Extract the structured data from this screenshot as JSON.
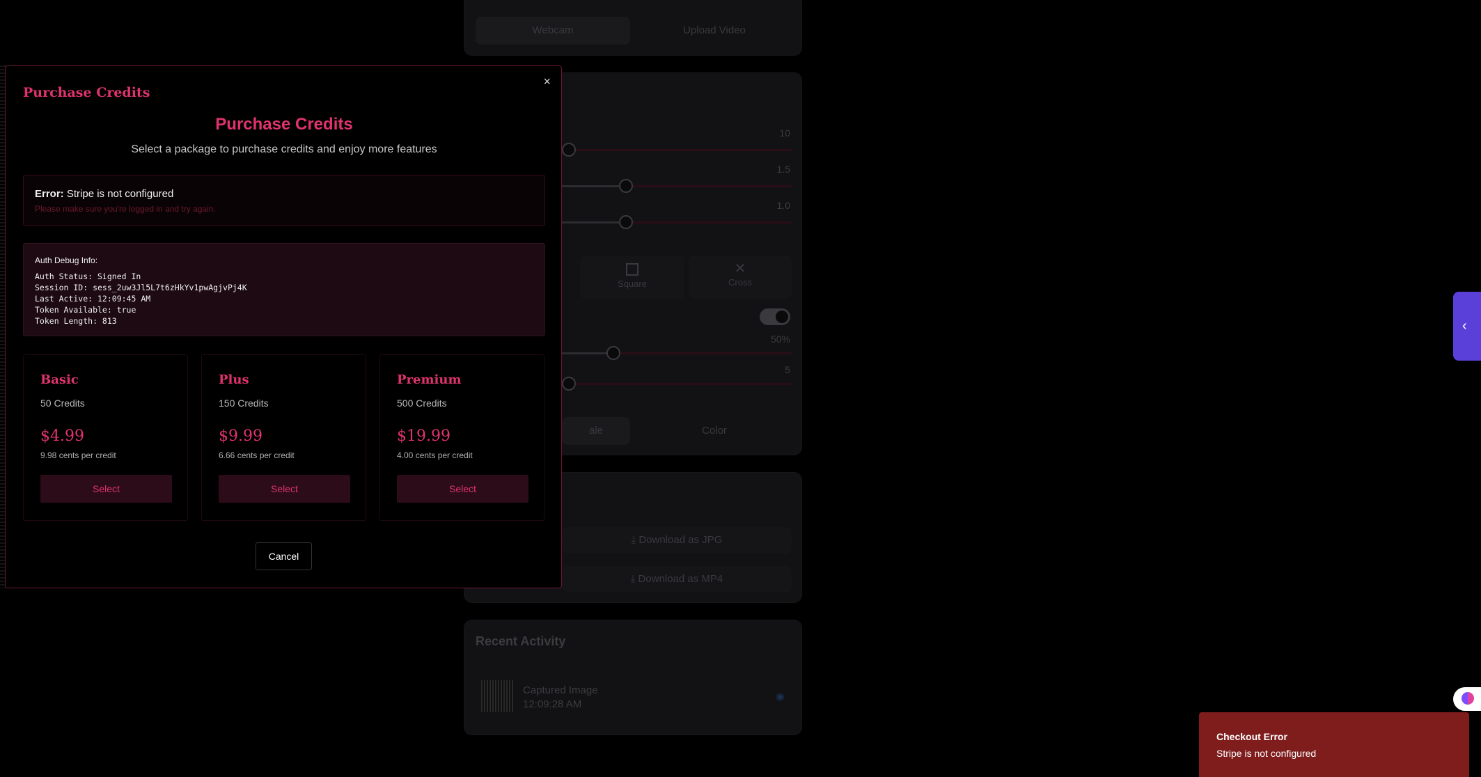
{
  "background": {
    "source_tabs": [
      "Webcam",
      "Upload Video"
    ],
    "slider_values": [
      "10",
      "1.5",
      "1.0",
      "50%",
      "5"
    ],
    "shapes": [
      "Square",
      "Cross"
    ],
    "mode_tabs": [
      "ale",
      "Color"
    ],
    "downloads": [
      "Download as JPG",
      "Download as MP4"
    ],
    "recent": {
      "title": "Recent Activity",
      "item_title": "Captured Image",
      "item_time": "12:09:28 AM"
    }
  },
  "modal": {
    "header_title": "Purchase Credits",
    "heading": "Purchase Credits",
    "subtitle": "Select a package to purchase credits and enjoy more features",
    "close_glyph": "×",
    "error": {
      "label": "Error:",
      "message": "Stripe is not configured",
      "hint": "Please make sure you're logged in and try again."
    },
    "debug": {
      "title": "Auth Debug Info:",
      "lines": "Auth Status: Signed In\nSession ID: sess_2uw3Jl5L7t6zHkYv1pwAgjvPj4K\nLast Active: 12:09:45 AM\nToken Available: true\nToken Length: 813"
    },
    "packages": [
      {
        "name": "Basic",
        "credits": "50 Credits",
        "price": "$4.99",
        "per": "9.98 cents per credit",
        "button": "Select"
      },
      {
        "name": "Plus",
        "credits": "150 Credits",
        "price": "$9.99",
        "per": "6.66 cents per credit",
        "button": "Select"
      },
      {
        "name": "Premium",
        "credits": "500 Credits",
        "price": "$19.99",
        "per": "4.00 cents per credit",
        "button": "Select"
      }
    ],
    "cancel": "Cancel"
  },
  "toast": {
    "title": "Checkout Error",
    "message": "Stripe is not configured"
  },
  "side_tab_glyph": "‹",
  "colors": {
    "accent": "#e0336e",
    "toast": "#7f1d1d",
    "side_tab": "#5b3fd9"
  }
}
